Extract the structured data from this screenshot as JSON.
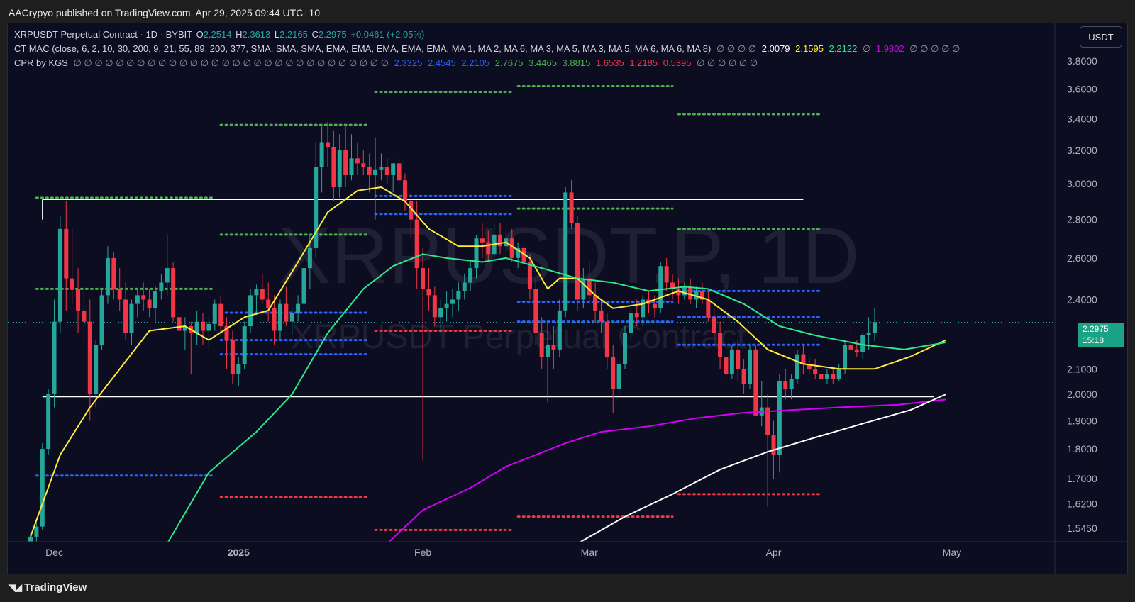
{
  "header": {
    "published": "AACrypyo published on TradingView.com, Apr 29, 2025 09:44 UTC+10"
  },
  "legend": {
    "symbol": "XRPUSDT Perpetual Contract · 1D · BYBIT",
    "o_label": "O",
    "o": "2.2514",
    "h_label": "H",
    "h": "2.3613",
    "l_label": "L",
    "l": "2.2165",
    "c_label": "C",
    "c": "2.2975",
    "change": "+0.0461 (+2.05%)",
    "mac_name": "CT MAC (close, 6, 2, 10, 30, 200, 9, 21, 55, 89, 200, 377, SMA, SMA, SMA, EMA, EMA, EMA, EMA, EMA, MA 1, MA 2, MA 6, MA 3, MA 5, MA 3, MA 5, MA 6, MA 6, MA 8)",
    "mac_empties1": "∅ ∅ ∅ ∅",
    "mac_v1": "2.0079",
    "mac_v2": "2.1595",
    "mac_v3": "2.2122",
    "mac_sep": "∅",
    "mac_v4": "1.9802",
    "mac_empties2": "∅ ∅ ∅ ∅ ∅",
    "cpr_name": "CPR by KGS",
    "cpr_empties1": "∅ ∅ ∅ ∅ ∅ ∅ ∅ ∅ ∅ ∅ ∅ ∅ ∅ ∅ ∅ ∅ ∅ ∅ ∅ ∅ ∅ ∅ ∅ ∅ ∅ ∅ ∅ ∅ ∅ ∅",
    "cpr_v1": "2.3325",
    "cpr_v2": "2.4545",
    "cpr_v3": "2.2105",
    "cpr_v4": "2.7675",
    "cpr_v5": "3.4465",
    "cpr_v6": "3.8815",
    "cpr_v7": "1.6535",
    "cpr_v8": "1.2185",
    "cpr_v9": "0.5395",
    "cpr_empties2": "∅ ∅ ∅ ∅ ∅ ∅"
  },
  "toolbar": {
    "currency": "USDT"
  },
  "price_tag": {
    "price": "2.2975",
    "countdown": "15:18"
  },
  "watermark": {
    "big": "XRPUSDT.P, 1D",
    "small": "XRPUSDT Perpetual Contract"
  },
  "footer": {
    "brand": "TradingView"
  },
  "colors": {
    "up": "#26a69a",
    "down": "#f23645",
    "ema_yellow": "#ffeb3b",
    "ema_green": "#2ee88a",
    "ma_magenta": "#d500f9",
    "ma_white": "#ffffff",
    "cpr_green": "#4caf50",
    "cpr_blue": "#2962ff",
    "cpr_red": "#f23645",
    "background": "#0c0d20"
  },
  "chart_data": {
    "type": "candlestick",
    "y_scale": "log",
    "ylim": [
      1.5,
      3.85
    ],
    "y_ticks": [
      "3.8000",
      "3.6000",
      "3.4000",
      "3.2000",
      "3.0000",
      "2.8000",
      "2.6000",
      "2.4000",
      "2.1000",
      "2.0000",
      "1.9000",
      "1.8000",
      "1.7000",
      "1.6200",
      "1.5450"
    ],
    "x_labels": [
      {
        "label": "Dec",
        "date": "2024-12-01"
      },
      {
        "label": "2025",
        "date": "2025-01-01"
      },
      {
        "label": "Feb",
        "date": "2025-02-01"
      },
      {
        "label": "Mar",
        "date": "2025-03-01"
      },
      {
        "label": "Apr",
        "date": "2025-04-01"
      },
      {
        "label": "May",
        "date": "2025-05-01"
      }
    ],
    "first_candle_date": "2024-11-27",
    "ohlc": [
      [
        1.5,
        1.53,
        1.48,
        1.52
      ],
      [
        1.52,
        1.56,
        1.5,
        1.55
      ],
      [
        1.55,
        1.82,
        1.54,
        1.8
      ],
      [
        1.8,
        2.02,
        1.78,
        2.0
      ],
      [
        2.0,
        2.4,
        1.95,
        2.3
      ],
      [
        2.3,
        2.82,
        2.25,
        2.75
      ],
      [
        2.75,
        2.9,
        2.35,
        2.5
      ],
      [
        2.5,
        2.75,
        2.38,
        2.45
      ],
      [
        2.45,
        2.55,
        2.25,
        2.35
      ],
      [
        2.35,
        2.45,
        2.2,
        2.3
      ],
      [
        2.3,
        2.4,
        1.9,
        2.0
      ],
      [
        2.0,
        2.22,
        1.95,
        2.2
      ],
      [
        2.2,
        2.45,
        2.18,
        2.42
      ],
      [
        2.42,
        2.66,
        2.38,
        2.6
      ],
      [
        2.6,
        2.63,
        2.4,
        2.45
      ],
      [
        2.45,
        2.55,
        2.35,
        2.4
      ],
      [
        2.4,
        2.48,
        2.22,
        2.25
      ],
      [
        2.25,
        2.4,
        2.2,
        2.38
      ],
      [
        2.38,
        2.45,
        2.32,
        2.42
      ],
      [
        2.42,
        2.48,
        2.35,
        2.4
      ],
      [
        2.4,
        2.45,
        2.32,
        2.36
      ],
      [
        2.36,
        2.46,
        2.3,
        2.44
      ],
      [
        2.44,
        2.52,
        2.4,
        2.48
      ],
      [
        2.48,
        2.72,
        2.42,
        2.55
      ],
      [
        2.55,
        2.58,
        2.3,
        2.32
      ],
      [
        2.32,
        2.38,
        2.2,
        2.26
      ],
      [
        2.26,
        2.32,
        2.18,
        2.28
      ],
      [
        2.28,
        2.3,
        2.08,
        2.25
      ],
      [
        2.25,
        2.35,
        2.2,
        2.3
      ],
      [
        2.3,
        2.34,
        2.2,
        2.26
      ],
      [
        2.26,
        2.32,
        2.18,
        2.29
      ],
      [
        2.29,
        2.4,
        2.26,
        2.38
      ],
      [
        2.38,
        2.42,
        2.25,
        2.28
      ],
      [
        2.28,
        2.32,
        2.1,
        2.22
      ],
      [
        2.22,
        2.26,
        2.04,
        2.08
      ],
      [
        2.08,
        2.15,
        2.03,
        2.12
      ],
      [
        2.12,
        2.3,
        2.1,
        2.28
      ],
      [
        2.28,
        2.45,
        2.25,
        2.42
      ],
      [
        2.42,
        2.47,
        2.33,
        2.45
      ],
      [
        2.45,
        2.52,
        2.38,
        2.4
      ],
      [
        2.4,
        2.48,
        2.3,
        2.36
      ],
      [
        2.36,
        2.42,
        2.2,
        2.26
      ],
      [
        2.26,
        2.4,
        2.22,
        2.38
      ],
      [
        2.38,
        2.46,
        2.28,
        2.3
      ],
      [
        2.3,
        2.36,
        2.24,
        2.34
      ],
      [
        2.34,
        2.42,
        2.3,
        2.38
      ],
      [
        2.38,
        2.62,
        2.32,
        2.55
      ],
      [
        2.55,
        2.72,
        2.45,
        2.65
      ],
      [
        2.65,
        3.25,
        2.6,
        3.1
      ],
      [
        3.1,
        3.35,
        2.95,
        3.25
      ],
      [
        3.25,
        3.38,
        3.1,
        3.22
      ],
      [
        3.22,
        3.32,
        2.9,
        2.98
      ],
      [
        2.98,
        3.3,
        2.92,
        3.2
      ],
      [
        3.2,
        3.36,
        2.98,
        3.05
      ],
      [
        3.05,
        3.3,
        3.02,
        3.15
      ],
      [
        3.15,
        3.25,
        3.05,
        3.12
      ],
      [
        3.12,
        3.2,
        3.05,
        3.1
      ],
      [
        3.1,
        3.18,
        2.95,
        3.05
      ],
      [
        3.05,
        3.28,
        2.8,
        3.08
      ],
      [
        3.08,
        3.18,
        3.02,
        3.1
      ],
      [
        3.1,
        3.15,
        3.0,
        3.05
      ],
      [
        3.05,
        3.12,
        2.95,
        3.12
      ],
      [
        3.12,
        3.16,
        3.0,
        3.02
      ],
      [
        3.02,
        3.06,
        2.85,
        2.9
      ],
      [
        2.9,
        2.95,
        2.7,
        2.8
      ],
      [
        2.8,
        2.9,
        2.45,
        2.55
      ],
      [
        2.55,
        2.65,
        1.76,
        2.45
      ],
      [
        2.45,
        2.55,
        2.35,
        2.42
      ],
      [
        2.42,
        2.46,
        2.28,
        2.32
      ],
      [
        2.32,
        2.4,
        2.25,
        2.36
      ],
      [
        2.36,
        2.44,
        2.3,
        2.38
      ],
      [
        2.38,
        2.45,
        2.32,
        2.4
      ],
      [
        2.4,
        2.48,
        2.35,
        2.44
      ],
      [
        2.44,
        2.52,
        2.4,
        2.48
      ],
      [
        2.48,
        2.58,
        2.44,
        2.55
      ],
      [
        2.55,
        2.72,
        2.5,
        2.7
      ],
      [
        2.7,
        2.78,
        2.6,
        2.68
      ],
      [
        2.68,
        2.74,
        2.58,
        2.62
      ],
      [
        2.62,
        2.78,
        2.58,
        2.72
      ],
      [
        2.72,
        2.78,
        2.62,
        2.66
      ],
      [
        2.66,
        2.74,
        2.6,
        2.7
      ],
      [
        2.7,
        2.75,
        2.58,
        2.6
      ],
      [
        2.6,
        2.68,
        2.55,
        2.65
      ],
      [
        2.65,
        2.7,
        2.55,
        2.58
      ],
      [
        2.58,
        2.62,
        2.4,
        2.45
      ],
      [
        2.45,
        2.5,
        2.2,
        2.25
      ],
      [
        2.25,
        2.32,
        2.1,
        2.15
      ],
      [
        2.15,
        2.3,
        1.97,
        2.2
      ],
      [
        2.2,
        2.28,
        2.1,
        2.18
      ],
      [
        2.18,
        2.4,
        2.15,
        2.35
      ],
      [
        2.35,
        2.98,
        2.32,
        2.95
      ],
      [
        2.95,
        3.02,
        2.75,
        2.78
      ],
      [
        2.78,
        2.82,
        2.35,
        2.4
      ],
      [
        2.4,
        2.55,
        2.36,
        2.5
      ],
      [
        2.5,
        2.58,
        2.38,
        2.42
      ],
      [
        2.42,
        2.48,
        2.3,
        2.35
      ],
      [
        2.35,
        2.4,
        2.25,
        2.3
      ],
      [
        2.3,
        2.34,
        2.1,
        2.15
      ],
      [
        2.15,
        2.2,
        1.93,
        2.02
      ],
      [
        2.02,
        2.14,
        2.0,
        2.12
      ],
      [
        2.12,
        2.28,
        2.1,
        2.25
      ],
      [
        2.25,
        2.36,
        2.22,
        2.34
      ],
      [
        2.34,
        2.4,
        2.28,
        2.32
      ],
      [
        2.32,
        2.42,
        2.28,
        2.4
      ],
      [
        2.4,
        2.44,
        2.34,
        2.38
      ],
      [
        2.38,
        2.42,
        2.32,
        2.36
      ],
      [
        2.36,
        2.58,
        2.34,
        2.56
      ],
      [
        2.56,
        2.6,
        2.44,
        2.48
      ],
      [
        2.48,
        2.52,
        2.4,
        2.45
      ],
      [
        2.45,
        2.5,
        2.38,
        2.42
      ],
      [
        2.42,
        2.48,
        2.4,
        2.46
      ],
      [
        2.46,
        2.5,
        2.38,
        2.4
      ],
      [
        2.4,
        2.46,
        2.36,
        2.44
      ],
      [
        2.44,
        2.48,
        2.38,
        2.4
      ],
      [
        2.4,
        2.44,
        2.3,
        2.32
      ],
      [
        2.32,
        2.36,
        2.22,
        2.25
      ],
      [
        2.25,
        2.3,
        2.1,
        2.15
      ],
      [
        2.15,
        2.2,
        2.05,
        2.08
      ],
      [
        2.08,
        2.2,
        2.06,
        2.18
      ],
      [
        2.18,
        2.22,
        2.05,
        2.1
      ],
      [
        2.1,
        2.14,
        2.0,
        2.04
      ],
      [
        2.04,
        2.2,
        2.02,
        2.18
      ],
      [
        2.18,
        2.2,
        2.0,
        1.92
      ],
      [
        1.92,
        2.05,
        1.88,
        1.95
      ],
      [
        1.95,
        2.0,
        1.61,
        1.85
      ],
      [
        1.85,
        1.9,
        1.7,
        1.78
      ],
      [
        1.78,
        2.08,
        1.72,
        2.05
      ],
      [
        2.05,
        2.1,
        1.98,
        2.02
      ],
      [
        2.02,
        2.08,
        1.98,
        2.06
      ],
      [
        2.06,
        2.18,
        2.04,
        2.16
      ],
      [
        2.16,
        2.2,
        2.08,
        2.12
      ],
      [
        2.12,
        2.15,
        2.08,
        2.1
      ],
      [
        2.1,
        2.14,
        2.06,
        2.08
      ],
      [
        2.08,
        2.12,
        2.04,
        2.06
      ],
      [
        2.06,
        2.1,
        2.04,
        2.08
      ],
      [
        2.08,
        2.1,
        2.04,
        2.06
      ],
      [
        2.06,
        2.12,
        2.05,
        2.1
      ],
      [
        2.1,
        2.22,
        2.08,
        2.2
      ],
      [
        2.2,
        2.28,
        2.16,
        2.18
      ],
      [
        2.18,
        2.22,
        2.15,
        2.17
      ],
      [
        2.17,
        2.25,
        2.14,
        2.24
      ],
      [
        2.24,
        2.32,
        2.18,
        2.25
      ],
      [
        2.2514,
        2.3613,
        2.2165,
        2.2975
      ]
    ],
    "indicators": [
      {
        "name": "EMA 21",
        "color": "#ffeb3b",
        "points": [
          [
            0,
            1.52
          ],
          [
            5,
            1.78
          ],
          [
            10,
            1.95
          ],
          [
            20,
            2.26
          ],
          [
            26,
            2.28
          ],
          [
            30,
            2.22
          ],
          [
            36,
            2.32
          ],
          [
            40,
            2.35
          ],
          [
            45,
            2.58
          ],
          [
            50,
            2.84
          ],
          [
            55,
            2.96
          ],
          [
            59,
            2.98
          ],
          [
            63,
            2.9
          ],
          [
            67,
            2.75
          ],
          [
            72,
            2.66
          ],
          [
            76,
            2.66
          ],
          [
            80,
            2.68
          ],
          [
            84,
            2.6
          ],
          [
            87,
            2.45
          ],
          [
            89,
            2.5
          ],
          [
            92,
            2.5
          ],
          [
            95,
            2.42
          ],
          [
            98,
            2.36
          ],
          [
            103,
            2.38
          ],
          [
            109,
            2.44
          ],
          [
            114,
            2.4
          ],
          [
            119,
            2.3
          ],
          [
            124,
            2.18
          ],
          [
            130,
            2.12
          ],
          [
            136,
            2.1
          ],
          [
            142,
            2.1
          ],
          [
            148,
            2.15
          ],
          [
            154,
            2.22
          ]
        ]
      },
      {
        "name": "EMA 55",
        "color": "#2ee88a",
        "points": [
          [
            23,
            1.5
          ],
          [
            30,
            1.72
          ],
          [
            38,
            1.86
          ],
          [
            44,
            2.0
          ],
          [
            50,
            2.25
          ],
          [
            56,
            2.45
          ],
          [
            61,
            2.56
          ],
          [
            66,
            2.62
          ],
          [
            70,
            2.6
          ],
          [
            76,
            2.58
          ],
          [
            80,
            2.6
          ],
          [
            86,
            2.55
          ],
          [
            92,
            2.5
          ],
          [
            98,
            2.48
          ],
          [
            104,
            2.44
          ],
          [
            110,
            2.46
          ],
          [
            114,
            2.45
          ],
          [
            120,
            2.38
          ],
          [
            126,
            2.28
          ],
          [
            132,
            2.24
          ],
          [
            140,
            2.2
          ],
          [
            147,
            2.18
          ],
          [
            154,
            2.21
          ]
        ]
      },
      {
        "name": "MA 200",
        "color": "#d500f9",
        "points": [
          [
            60,
            1.5
          ],
          [
            66,
            1.6
          ],
          [
            74,
            1.67
          ],
          [
            80,
            1.74
          ],
          [
            90,
            1.82
          ],
          [
            96,
            1.86
          ],
          [
            104,
            1.88
          ],
          [
            112,
            1.91
          ],
          [
            120,
            1.93
          ],
          [
            128,
            1.94
          ],
          [
            136,
            1.95
          ],
          [
            146,
            1.96
          ],
          [
            154,
            1.98
          ]
        ]
      },
      {
        "name": "MA 377",
        "color": "#ffffff",
        "points": [
          [
            92,
            1.5
          ],
          [
            100,
            1.58
          ],
          [
            108,
            1.65
          ],
          [
            116,
            1.73
          ],
          [
            124,
            1.79
          ],
          [
            132,
            1.84
          ],
          [
            140,
            1.89
          ],
          [
            148,
            1.94
          ],
          [
            154,
            2.0
          ]
        ]
      }
    ],
    "horizontal_lines": [
      {
        "price": 2.91,
        "from": 2,
        "to": 130,
        "color": "#ffffff"
      },
      {
        "price": 1.99,
        "from": 2,
        "to": 152,
        "color": "#ffffff"
      }
    ],
    "cpr_levels": [
      {
        "from": 1,
        "to": 31,
        "green": [
          2.92,
          2.45
        ],
        "blue": [
          1.71
        ],
        "red": []
      },
      {
        "from": 32,
        "to": 57,
        "green": [
          3.36,
          2.72
        ],
        "blue": [
          2.34,
          2.22,
          2.16
        ],
        "red": [
          1.64
        ]
      },
      {
        "from": 58,
        "to": 81,
        "green": [
          3.58
        ],
        "blue": [
          2.93,
          2.83
        ],
        "red": [
          2.26,
          1.54
        ]
      },
      {
        "from": 82,
        "to": 108,
        "green": [
          3.62,
          2.86
        ],
        "blue": [
          2.39,
          2.3
        ],
        "red": [
          1.58
        ]
      },
      {
        "from": 109,
        "to": 133,
        "green": [
          3.43,
          2.75
        ],
        "blue": [
          2.44,
          2.32,
          2.2
        ],
        "red": [
          1.65
        ]
      }
    ]
  }
}
